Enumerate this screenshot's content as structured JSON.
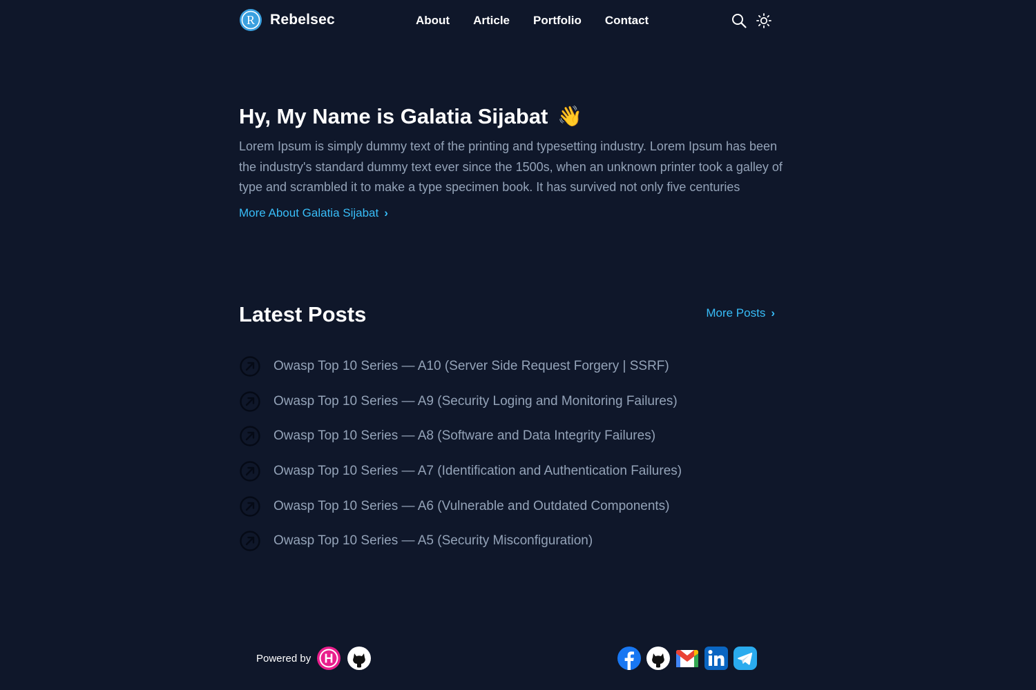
{
  "header": {
    "brand_name": "Rebelsec",
    "logo_icon": "r-logo-icon",
    "nav": [
      "About",
      "Article",
      "Portfolio",
      "Contact"
    ],
    "actions": [
      "search-icon",
      "sun-icon"
    ]
  },
  "hero": {
    "title": "Hy, My Name is Galatia Sijabat",
    "emoji": "👋",
    "text": "Lorem Ipsum is simply dummy text of the printing and typesetting industry. Lorem Ipsum has been the industry's standard dummy text ever since the 1500s, when an unknown printer took a galley of type and scrambled it to make a type specimen book. It has survived not only five centuries",
    "more_label": "More About Galatia Sijabat",
    "more_chevron": "›"
  },
  "posts": {
    "title": "Latest Posts",
    "more_label": "More Posts",
    "more_chevron": "›",
    "items": [
      "Owasp Top 10 Series — A10 (Server Side Request Forgery | SSRF)",
      "Owasp Top 10 Series — A9 (Security Loging and Monitoring Failures)",
      "Owasp Top 10 Series — A8 (Software and Data Integrity Failures)",
      "Owasp Top 10 Series — A7 (Identification and Authentication Failures)",
      "Owasp Top 10 Series — A6 (Vulnerable and Outdated Components)",
      "Owasp Top 10 Series — A5 (Security Misconfiguration)"
    ]
  },
  "footer": {
    "powered_by": "Powered by",
    "powered_icons": [
      "hashnode-icon",
      "github-icon"
    ],
    "social_icons": [
      "facebook-icon",
      "github-icon",
      "gmail-icon",
      "linkedin-icon",
      "telegram-icon"
    ]
  },
  "colors": {
    "background": "#0f172a",
    "accent": "#38bdf8",
    "muted_text": "#94a3b8"
  }
}
